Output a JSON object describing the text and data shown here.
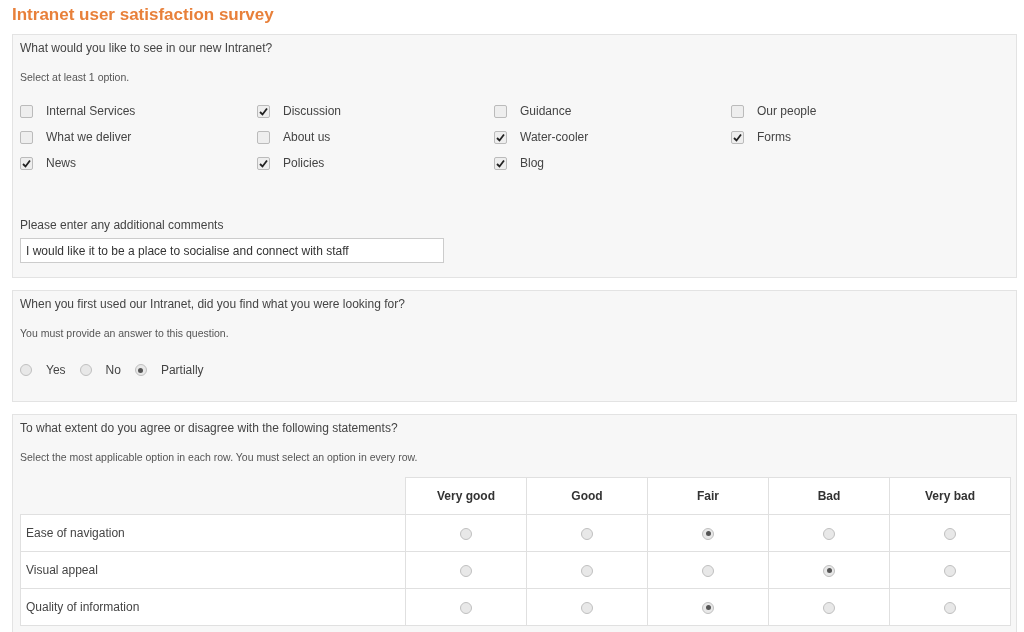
{
  "title": "Intranet user satisfaction survey",
  "questions": [
    {
      "kind": "checkboxes",
      "question": "What would you like to see in our new Intranet?",
      "hint": "Select at least 1 option.",
      "options": [
        {
          "label": "Internal Services",
          "checked": false
        },
        {
          "label": "Discussion",
          "checked": true
        },
        {
          "label": "Guidance",
          "checked": false
        },
        {
          "label": "Our people",
          "checked": false
        },
        {
          "label": "What we deliver",
          "checked": false
        },
        {
          "label": "About us",
          "checked": false
        },
        {
          "label": "Water-cooler",
          "checked": true
        },
        {
          "label": "Forms",
          "checked": true
        },
        {
          "label": "News",
          "checked": true
        },
        {
          "label": "Policies",
          "checked": true
        },
        {
          "label": "Blog",
          "checked": true
        }
      ],
      "comment_label": "Please enter any additional comments",
      "comment_value": "I would like it to be a place to socialise and connect with staff"
    },
    {
      "kind": "radios",
      "question": "When you first used our Intranet, did you find what you were looking for?",
      "hint": "You must provide an answer to this question.",
      "options": [
        {
          "label": "Yes",
          "selected": false
        },
        {
          "label": "No",
          "selected": false
        },
        {
          "label": "Partially",
          "selected": true
        }
      ]
    },
    {
      "kind": "matrix",
      "question": "To what extent do you agree or disagree with the following statements?",
      "hint": "Select the most applicable option in each row. You must select an option in every row.",
      "columns": [
        "Very good",
        "Good",
        "Fair",
        "Bad",
        "Very bad"
      ],
      "rows": [
        {
          "label": "Ease of navigation",
          "choices": [
            {
              "selected": false
            },
            {
              "selected": false
            },
            {
              "selected": true
            },
            {
              "selected": false
            },
            {
              "selected": false
            }
          ]
        },
        {
          "label": "Visual appeal",
          "choices": [
            {
              "selected": false
            },
            {
              "selected": false
            },
            {
              "selected": false
            },
            {
              "selected": true
            },
            {
              "selected": false
            }
          ]
        },
        {
          "label": "Quality of information",
          "choices": [
            {
              "selected": false
            },
            {
              "selected": false
            },
            {
              "selected": true
            },
            {
              "selected": false
            },
            {
              "selected": false
            }
          ]
        }
      ]
    }
  ]
}
